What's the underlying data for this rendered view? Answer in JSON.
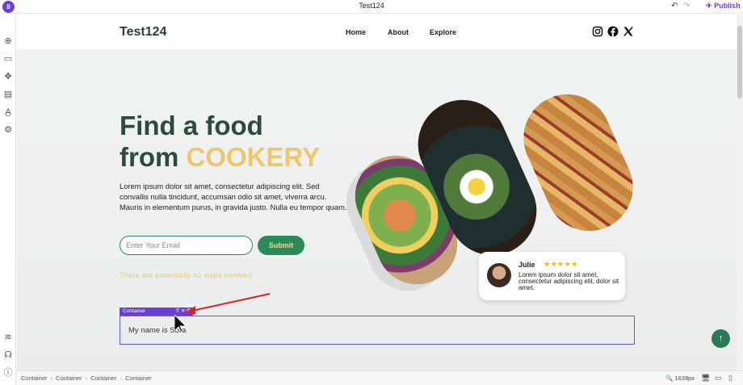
{
  "editor": {
    "title": "Test124",
    "publish_label": "Publish",
    "breadcrumbs": [
      "Container",
      "Container",
      "Container",
      "Container"
    ],
    "zoom": "1639px"
  },
  "site": {
    "brand": "Test124",
    "nav": [
      "Home",
      "About",
      "Explore"
    ],
    "hero_line1": "Find a food",
    "hero_line2a": "from ",
    "hero_line2b": "COOKERY",
    "hero_text": "Lorem ipsum dolor sit amet, consectetur adipiscing elit. Sed convallis nulla tincidunt, accumsan odio sit amet, viverra arcu. Mauris in elementum purus, in gravida justo. Nulla eu tempor quam.",
    "email_placeholder": "Enter Your Email",
    "submit_label": "Submit",
    "tagline": "There are essentially no steps involved.",
    "review": {
      "name": "Julie",
      "stars": "★★★★★",
      "text": "Lorem ipsum dolor sit amet, consectetur adipiscing elit, dolor sit amet."
    },
    "container": {
      "label": "Container",
      "text": "My name is Sora"
    }
  },
  "colors": {
    "accent": "#6b3fd6",
    "brand_green": "#2b8a5a",
    "gold": "#ecc76f"
  }
}
